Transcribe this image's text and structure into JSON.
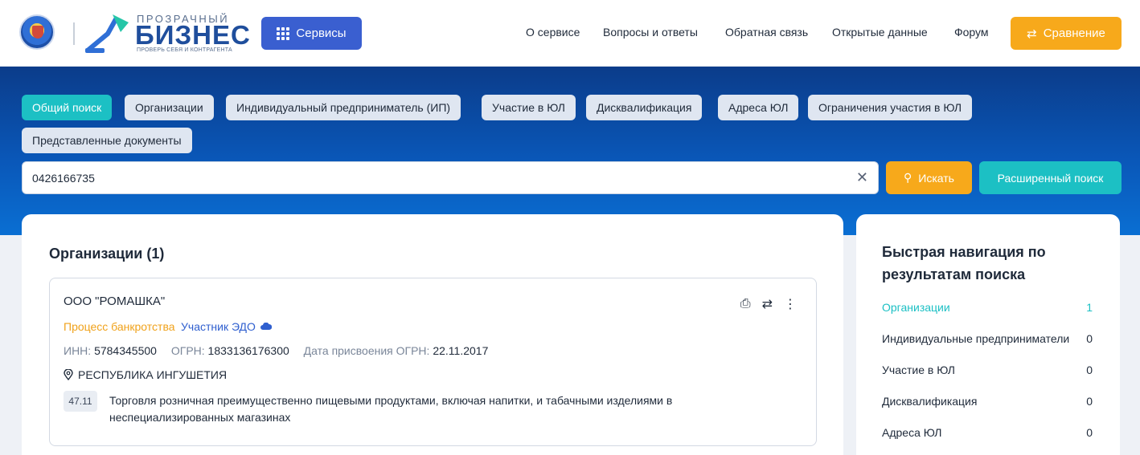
{
  "header": {
    "brand_top": "ПРОЗРАЧНЫЙ",
    "brand_main": "БИЗНЕС",
    "brand_sub": "ПРОВЕРЬ СЕБЯ И КОНТРАГЕНТА",
    "services_label": "Сервисы",
    "nav": [
      "О сервисе",
      "Вопросы и ответы",
      "Обратная связь",
      "Открытые данные",
      "Форум"
    ],
    "compare_label": "Сравнение"
  },
  "tabs": [
    "Общий поиск",
    "Организации",
    "Индивидуальный предприниматель (ИП)",
    "Участие в ЮЛ",
    "Дисквалификация",
    "Адреса ЮЛ",
    "Ограничения участия в ЮЛ",
    "Представленные документы"
  ],
  "search": {
    "value": "0426166735",
    "search_label": "Искать",
    "advanced_label": "Расширенный поиск"
  },
  "results": {
    "title": "Организации (1)",
    "org": {
      "name": "ООО \"РОМАШКА\"",
      "bankruptcy": "Процесс банкротства",
      "edo": "Участник ЭДО",
      "inn_label": "ИНН:",
      "inn": "5784345500",
      "ogrn_label": "ОГРН:",
      "ogrn": "1833136176300",
      "ogrn_date_label": "Дата присвоения ОГРН:",
      "ogrn_date": "22.11.2017",
      "address": "РЕСПУБЛИКА ИНГУШЕТИЯ",
      "okved_code": "47.11",
      "okved_text": "Торговля розничная преимущественно пищевыми продуктами, включая напитки, и табачными изделиями в неспециализированных магазинах"
    }
  },
  "quick_nav": {
    "title": "Быстрая навигация по результатам поиска",
    "items": [
      {
        "label": "Организации",
        "count": "1"
      },
      {
        "label": "Индивидуальные предприниматели",
        "count": "0"
      },
      {
        "label": "Участие в ЮЛ",
        "count": "0"
      },
      {
        "label": "Дисквалификация",
        "count": "0"
      },
      {
        "label": "Адреса ЮЛ",
        "count": "0"
      }
    ]
  },
  "colors": {
    "accent_teal": "#1cc0c4",
    "accent_orange": "#f7a91b",
    "brand_blue": "#3a5fd0"
  }
}
